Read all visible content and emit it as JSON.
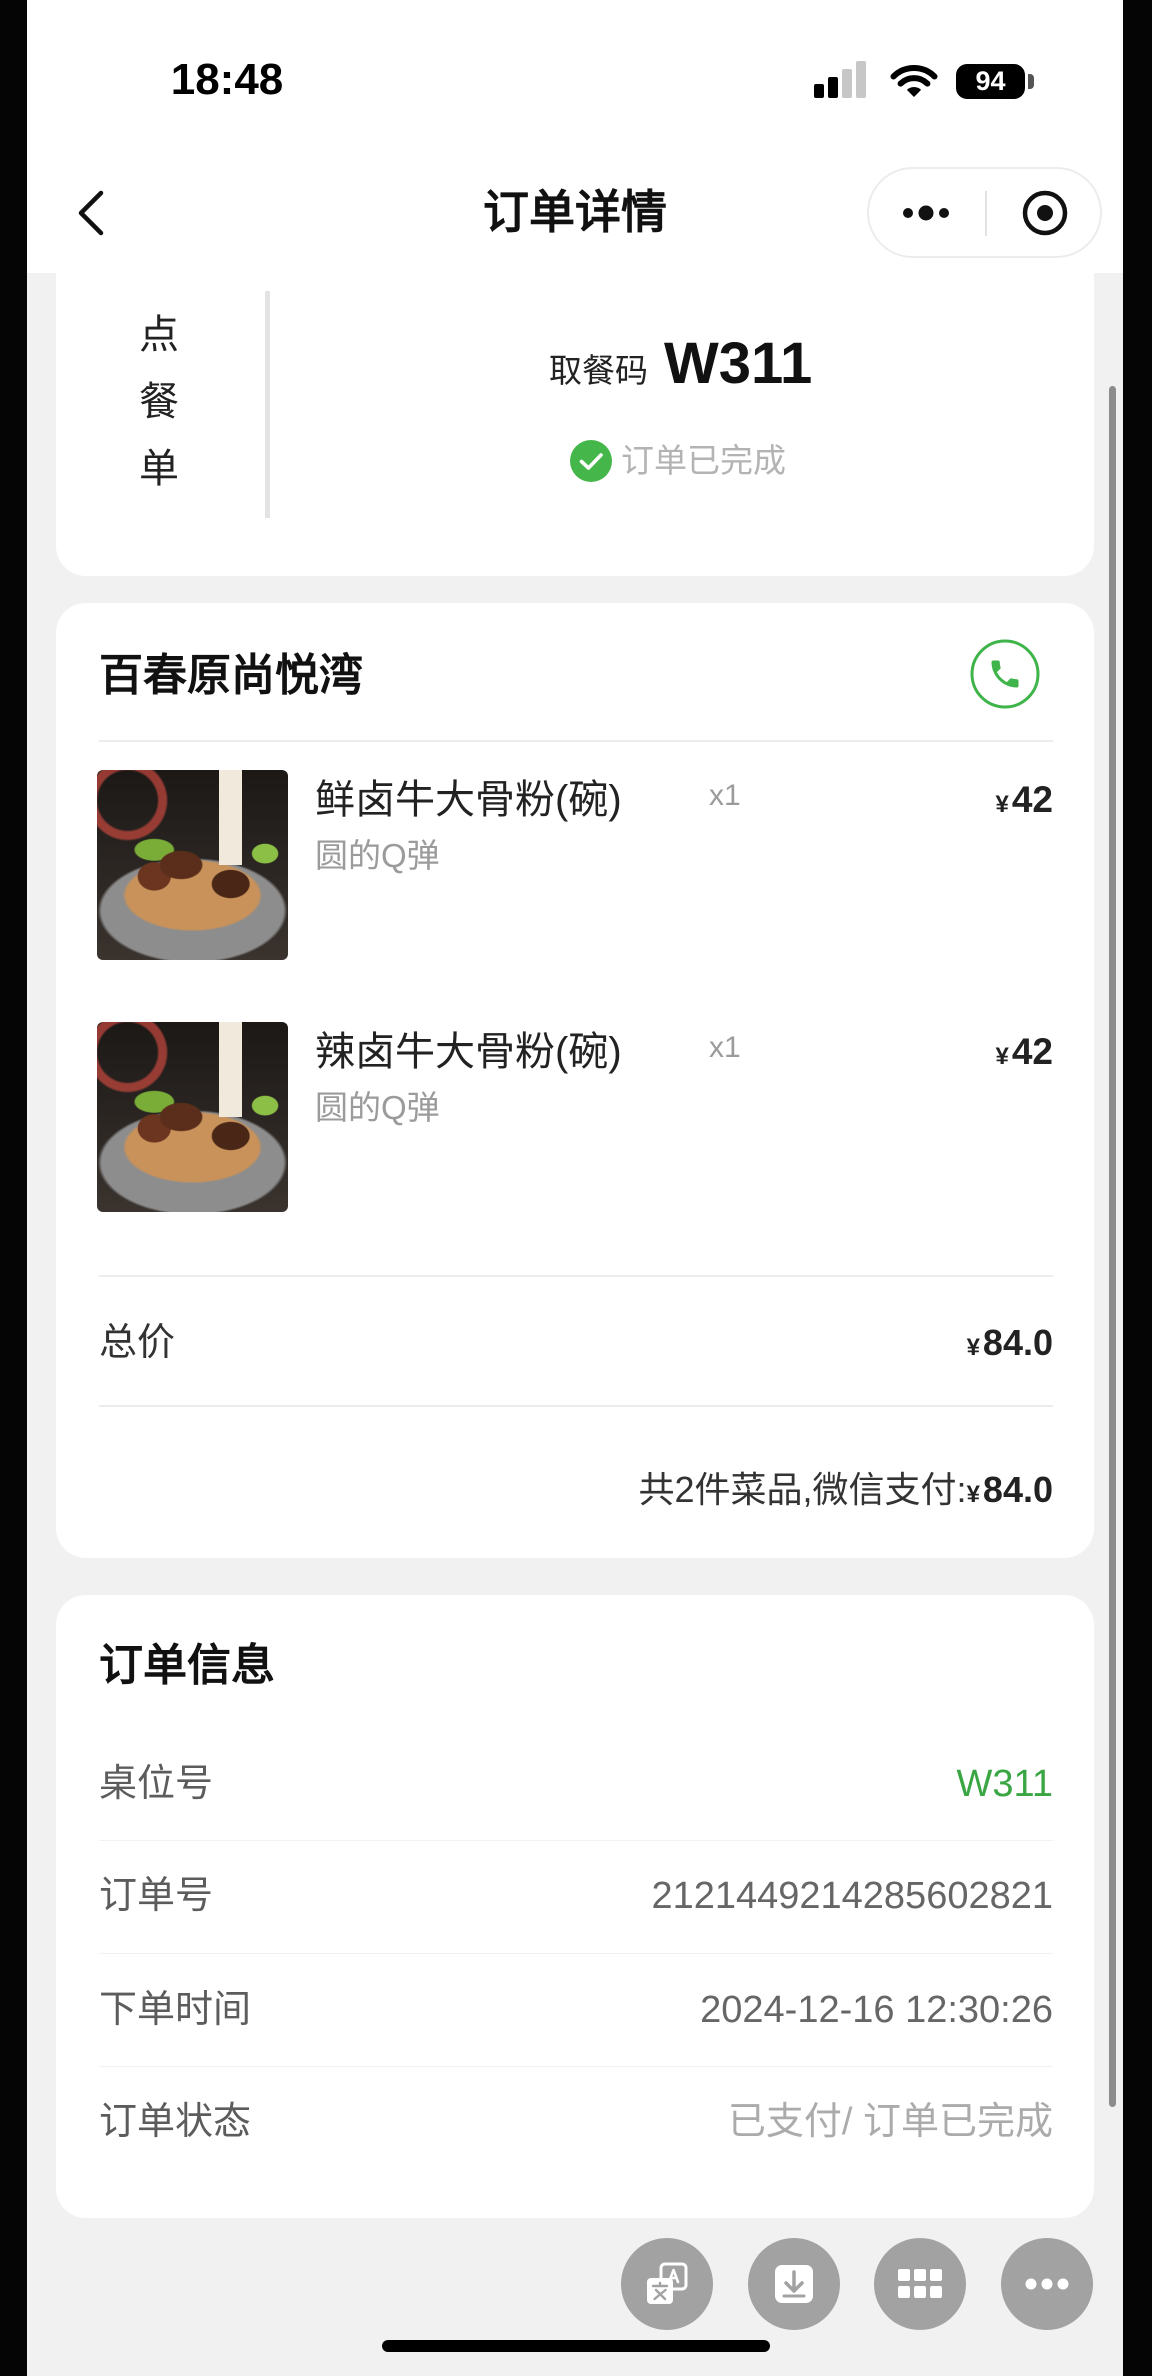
{
  "status_bar": {
    "time": "18:48",
    "battery": "94",
    "icons": [
      "signal-icon",
      "wifi-icon",
      "battery-icon"
    ]
  },
  "nav": {
    "title": "订单详情",
    "back_icon": "chevron-left-icon",
    "menu_icon": "more-dots-icon",
    "exit_icon": "target-circle-icon"
  },
  "pickup_card": {
    "side_tab": "点餐单",
    "code_label": "取餐码",
    "code": "W311",
    "status_icon": "check-circle-icon",
    "status": "订单已完成"
  },
  "store_card": {
    "store_name": "百春原尚悦湾",
    "phone_icon": "phone-icon",
    "items": [
      {
        "name": "鲜卤牛大骨粉(碗)",
        "qty": "x1",
        "currency": "¥",
        "price": "42",
        "spec": "圆的Q弹"
      },
      {
        "name": "辣卤牛大骨粉(碗)",
        "qty": "x1",
        "currency": "¥",
        "price": "42",
        "spec": "圆的Q弹"
      }
    ],
    "total": {
      "label": "总价",
      "currency": "¥",
      "amount": "84.0"
    },
    "summary": {
      "text": "共2件菜品,微信支付:",
      "currency": "¥",
      "amount": "84.0"
    }
  },
  "order_info": {
    "title": "订单信息",
    "rows": [
      {
        "label": "桌位号",
        "value": "W311"
      },
      {
        "label": "订单号",
        "value": "2121449214285602821"
      },
      {
        "label": "下单时间",
        "value": "2024-12-16 12:30:26"
      },
      {
        "label": "订单状态",
        "value": "已支付/ 订单已完成"
      }
    ]
  },
  "floating_actions": [
    {
      "icon": "translate-icon"
    },
    {
      "icon": "download-icon"
    },
    {
      "icon": "grid-icon"
    },
    {
      "icon": "more-dots-icon"
    }
  ],
  "colors": {
    "accent_green": "#3fb44a",
    "status_green": "#45b649",
    "page_bg": "#f1f1f1",
    "muted_text": "#9b9b9b"
  }
}
